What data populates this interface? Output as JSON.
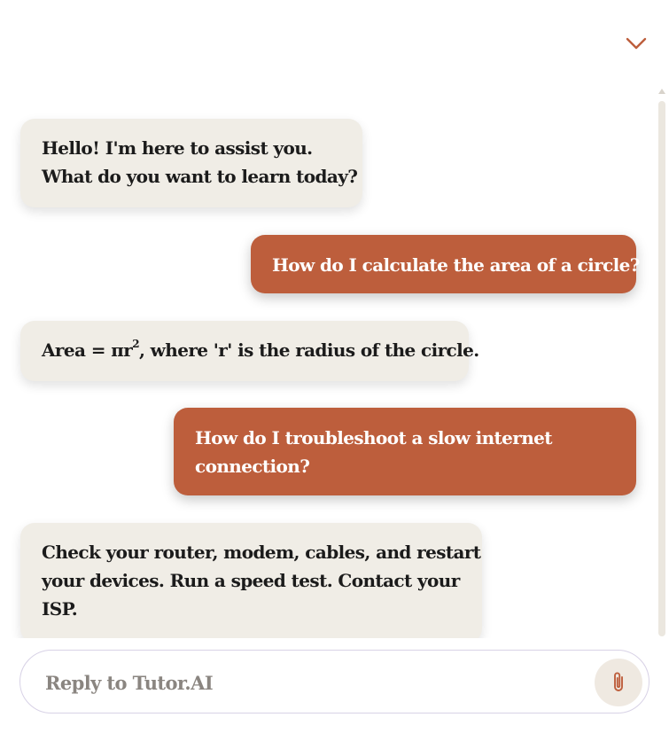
{
  "colors": {
    "accent": "#bd5e3c",
    "assistant_bubble": "#f0ede6",
    "user_text": "#ffffff"
  },
  "header": {
    "collapse_icon": "chevron-down-icon"
  },
  "messages": [
    {
      "role": "assistant",
      "lines": [
        "Hello! I'm here to assist you.",
        "What do you want to learn today?"
      ]
    },
    {
      "role": "user",
      "lines": [
        "How do I calculate the area of a circle?"
      ]
    },
    {
      "role": "assistant",
      "formula_prefix": "Area = πr",
      "formula_sup": "2",
      "formula_suffix": ", where 'r' is the radius of the circle."
    },
    {
      "role": "user",
      "lines": [
        "How do I troubleshoot a slow internet",
        "connection?"
      ]
    },
    {
      "role": "assistant",
      "lines": [
        "Check your router, modem, cables, and restart",
        "your devices. Run a speed test. Contact your",
        "ISP."
      ]
    }
  ],
  "composer": {
    "placeholder": "Reply to Tutor.AI",
    "value": "",
    "attach_icon": "paperclip-icon"
  }
}
